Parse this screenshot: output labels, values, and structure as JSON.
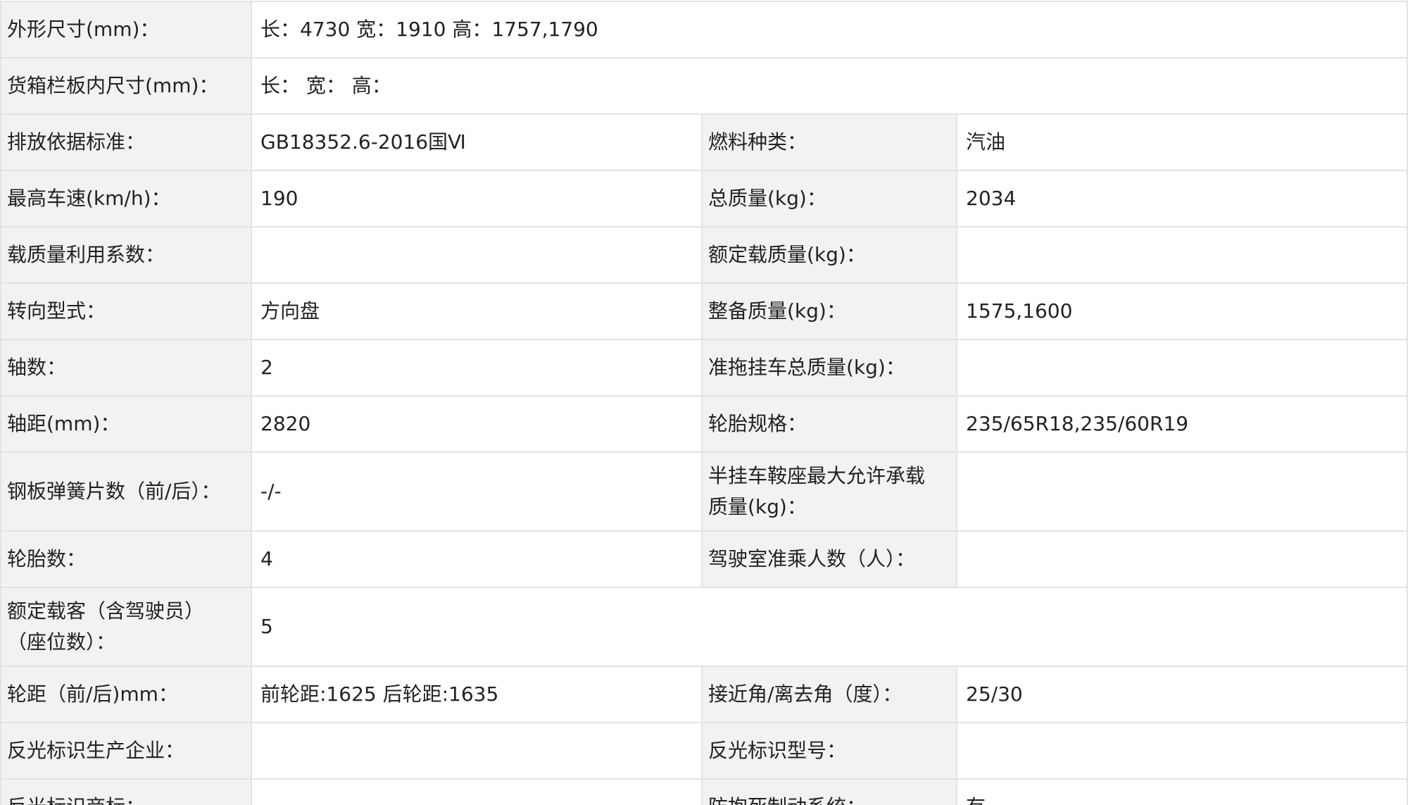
{
  "rows": [
    {
      "label": "外形尺寸(mm)：",
      "value": "长：4730 宽：1910 高：1757,1790"
    },
    {
      "label": "货箱栏板内尺寸(mm)：",
      "value": "长：  宽：  高："
    },
    {
      "label": "排放依据标准：",
      "value": "GB18352.6-2016国Ⅵ",
      "label2": "燃料种类：",
      "value2": "汽油"
    },
    {
      "label": "最高车速(km/h)：",
      "value": "190",
      "label2": "总质量(kg)：",
      "value2": "2034"
    },
    {
      "label": "载质量利用系数：",
      "value": "",
      "label2": "额定载质量(kg)：",
      "value2": ""
    },
    {
      "label": "转向型式：",
      "value": "方向盘",
      "label2": "整备质量(kg)：",
      "value2": "1575,1600"
    },
    {
      "label": "轴数：",
      "value": "2",
      "label2": "准拖挂车总质量(kg)：",
      "value2": ""
    },
    {
      "label": "轴距(mm)：",
      "value": "2820",
      "label2": "轮胎规格：",
      "value2": "235/65R18,235/60R19"
    },
    {
      "label": "钢板弹簧片数（前/后）：",
      "value": "-/-",
      "label2a": "半挂车鞍座最大允许承载",
      "label2b": "质量(kg)：",
      "value2": ""
    },
    {
      "label": "轮胎数：",
      "value": "4",
      "label2": "驾驶室准乘人数（人）：",
      "value2": ""
    },
    {
      "labela": "额定载客（含驾驶员）",
      "labelb": "（座位数）：",
      "value": "5"
    },
    {
      "label": "轮距（前/后)mm：",
      "value": "前轮距:1625 后轮距:1635",
      "label2": "接近角/离去角（度）：",
      "value2": "25/30"
    },
    {
      "label": "反光标识生产企业：",
      "value": "",
      "label2": "反光标识型号：",
      "value2": ""
    },
    {
      "label": "反光标识商标：",
      "value": "",
      "label2": "防抱死制动系统：",
      "value2": "有"
    }
  ]
}
